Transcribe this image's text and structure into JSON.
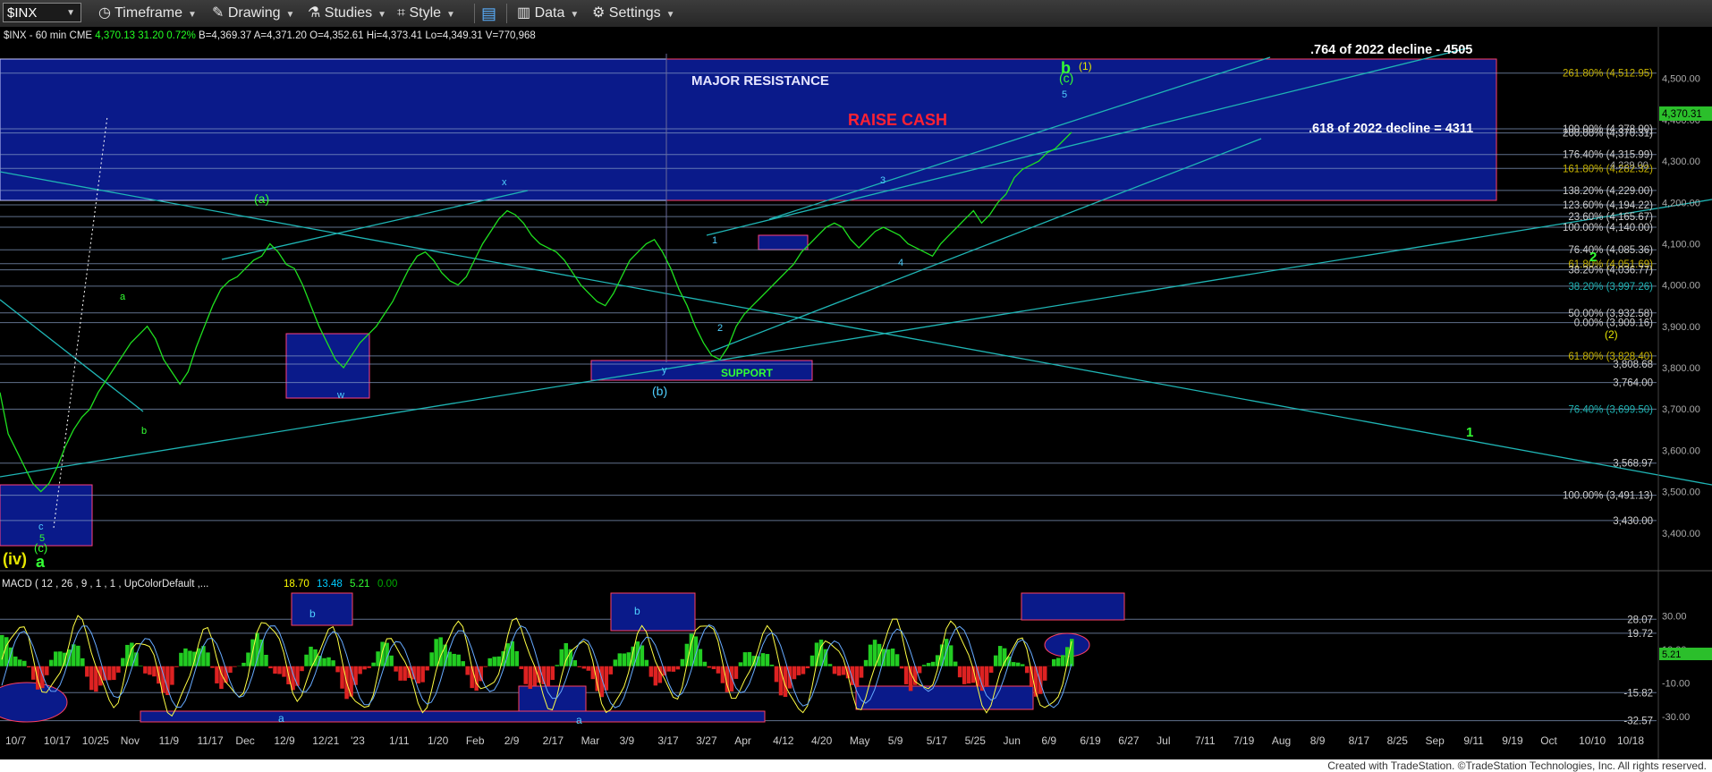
{
  "toolbar": {
    "symbol": "$INX",
    "timeframe": "Timeframe",
    "drawing": "Drawing",
    "studies": "Studies",
    "style": "Style",
    "data": "Data",
    "settings": "Settings"
  },
  "chart_data": {
    "type": "line",
    "symbol_line": {
      "symbol": "$INX - 60 min",
      "exchange": "CME",
      "last": "4,370.13",
      "change": "31.20",
      "pct": "0.72%",
      "bid": "B=4,369.37",
      "ask": "A=4,371.20",
      "open": "O=4,352.61",
      "high": "Hi=4,373.41",
      "low": "Lo=4,349.31",
      "volume": "V=770,968"
    },
    "ylim": [
      3380,
      4560
    ],
    "y_ticks": [
      "4,500.00",
      "4,400.00",
      "4,300.00",
      "4,200.00",
      "4,100.00",
      "4,000.00",
      "3,900.00",
      "3,800.00",
      "3,700.00",
      "3,600.00",
      "3,500.00",
      "3,400.00"
    ],
    "x_ticks": [
      "10/7",
      "10/17",
      "10/25",
      "Nov",
      "11/9",
      "11/17",
      "Dec",
      "12/9",
      "12/21",
      "'23",
      "1/11",
      "1/20",
      "Feb",
      "2/9",
      "2/17",
      "Mar",
      "3/9",
      "3/17",
      "3/27",
      "Apr",
      "4/12",
      "4/20",
      "May",
      "5/9",
      "5/17",
      "5/25",
      "Jun",
      "6/9",
      "6/19",
      "6/27",
      "Jul",
      "7/11",
      "7/19",
      "Aug",
      "8/9",
      "8/17",
      "8/25",
      "Sep",
      "9/11",
      "9/19",
      "Oct",
      "10/10",
      "10/18"
    ],
    "last_price_label": "4,370.31",
    "series": [
      {
        "values": [
          3740,
          3640,
          3600,
          3560,
          3520,
          3500,
          3520,
          3560,
          3610,
          3650,
          3680,
          3700,
          3740,
          3770,
          3800,
          3830,
          3860,
          3880,
          3900,
          3870,
          3820,
          3790,
          3760,
          3790,
          3850,
          3900,
          3950,
          3990,
          4010,
          4020,
          4040,
          4060,
          4070,
          4100,
          4080,
          4050,
          4040,
          4000,
          3950,
          3900,
          3860,
          3820,
          3800,
          3830,
          3860,
          3880,
          3900,
          3930,
          3960,
          4000,
          4040,
          4070,
          4080,
          4060,
          4030,
          4010,
          4000,
          4020,
          4060,
          4100,
          4130,
          4160,
          4180,
          4170,
          4150,
          4120,
          4100,
          4090,
          4080,
          4060,
          4030,
          4000,
          3980,
          3960,
          3950,
          3980,
          4020,
          4060,
          4080,
          4100,
          4110,
          4080,
          4040,
          3990,
          3950,
          3900,
          3860,
          3830,
          3820,
          3850,
          3900,
          3930,
          3950,
          3970,
          3990,
          4010,
          4030,
          4050,
          4080,
          4100,
          4120,
          4140,
          4150,
          4140,
          4110,
          4090,
          4110,
          4130,
          4140,
          4130,
          4120,
          4100,
          4090,
          4080,
          4070,
          4100,
          4120,
          4140,
          4160,
          4180,
          4150,
          4170,
          4200,
          4220,
          4260,
          4280,
          4290,
          4300,
          4320,
          4330,
          4350,
          4370
        ]
      }
    ],
    "price_labels": [
      {
        "text": "261.80% (4,512.95)",
        "y": 4512.95
      },
      {
        "text": "100.00% (4,378.00)",
        "y": 4378
      },
      {
        "text": "200.00% (4,370.31)",
        "y": 4368
      },
      {
        "text": "176.40% (4,315.99)",
        "y": 4315.99
      },
      {
        "text": "161.80% (4,282.32)",
        "y": 4282.32
      },
      {
        "text": "138.20% (4,229.00)",
        "y": 4229
      },
      {
        "text": "123.60% (4,194.22)",
        "y": 4194.22
      },
      {
        "text": "23.60% (4,165.67)",
        "y": 4165.67
      },
      {
        "text": "100.00% (4,140.00)",
        "y": 4140
      },
      {
        "text": "76.40% (4,085.36)",
        "y": 4085.36
      },
      {
        "text": "61.80% (4,051.69)",
        "y": 4051.69
      },
      {
        "text": "38.20% (4,036.77)",
        "y": 4036.77
      },
      {
        "text": "38.20% (3,997.26)",
        "y": 3997.26
      },
      {
        "text": "50.00% (3,932.58)",
        "y": 3932.58
      },
      {
        "text": "0.00% (3,909.16)",
        "y": 3909.16
      },
      {
        "text": "61.80% (3,828.40)",
        "y": 3828.4
      },
      {
        "text": "3,808.68",
        "y": 3808.68
      },
      {
        "text": "3,764.00",
        "y": 3764
      },
      {
        "text": "76.40% (3,699.50)",
        "y": 3699.5
      },
      {
        "text": "3,568.97",
        "y": 3568.97
      },
      {
        "text": "100.00% (3,491.13)",
        "y": 3491.13
      },
      {
        "text": "3,430.00",
        "y": 3430
      }
    ],
    "annotations": {
      "major_resistance": "MAJOR RESISTANCE",
      "raise_cash": "RAISE CASH",
      "support": "SUPPORT",
      "ratio_764": ".764 of 2022 decline - 4505",
      "ratio_618": ".618 of 2022 decline = 4311",
      "wave_b": "b",
      "wave_1_paren": "(1)",
      "wave_c_paren": "(c)",
      "wave_5": "5",
      "wave_a_paren": "(a)",
      "wave_b_paren": "(b)",
      "wave_x": "x",
      "wave_y": "y",
      "wave_w": "w",
      "wave_a": "a",
      "wave_b_small": "b",
      "wave_c": "c",
      "wave_5_low": "5",
      "wave_c_paren_low": "(c)",
      "wave_a_low": "a",
      "wave_iv": "(iv)",
      "count_1": "1",
      "count_2": "2",
      "count_3": "3",
      "count_4": "4",
      "wave_1_big": "1",
      "wave_2_big": "2",
      "wave_2_paren": "(2)",
      "level_4229": "4,229.00"
    },
    "macd": {
      "label": "MACD ( 12 , 26 , 9 , 1 , 1 , UpColorDefault ,...",
      "v1": "18.70",
      "v2": "13.48",
      "v3": "5.21",
      "v4": "0.00",
      "colors": {
        "v1": "#ffff00",
        "v2": "#00ccff",
        "v3": "#33ff33",
        "v4": "#00aa00"
      },
      "ylim": [
        -36,
        40
      ],
      "y_ticks": [
        "30.00",
        "10.00",
        "-10.00",
        "-30.00"
      ],
      "level_labels": [
        "28.07",
        "19.72",
        "-15.82",
        "-32.57"
      ],
      "level_values": [
        28.07,
        19.72,
        -15.82,
        -32.57
      ],
      "last_label": "5.21",
      "box_label_b1": "b",
      "box_label_b2": "b",
      "box_label_a1": "a",
      "box_label_a2": "a"
    }
  },
  "footer": "Created with TradeStation. ©TradeStation Technologies, Inc. All rights reserved."
}
